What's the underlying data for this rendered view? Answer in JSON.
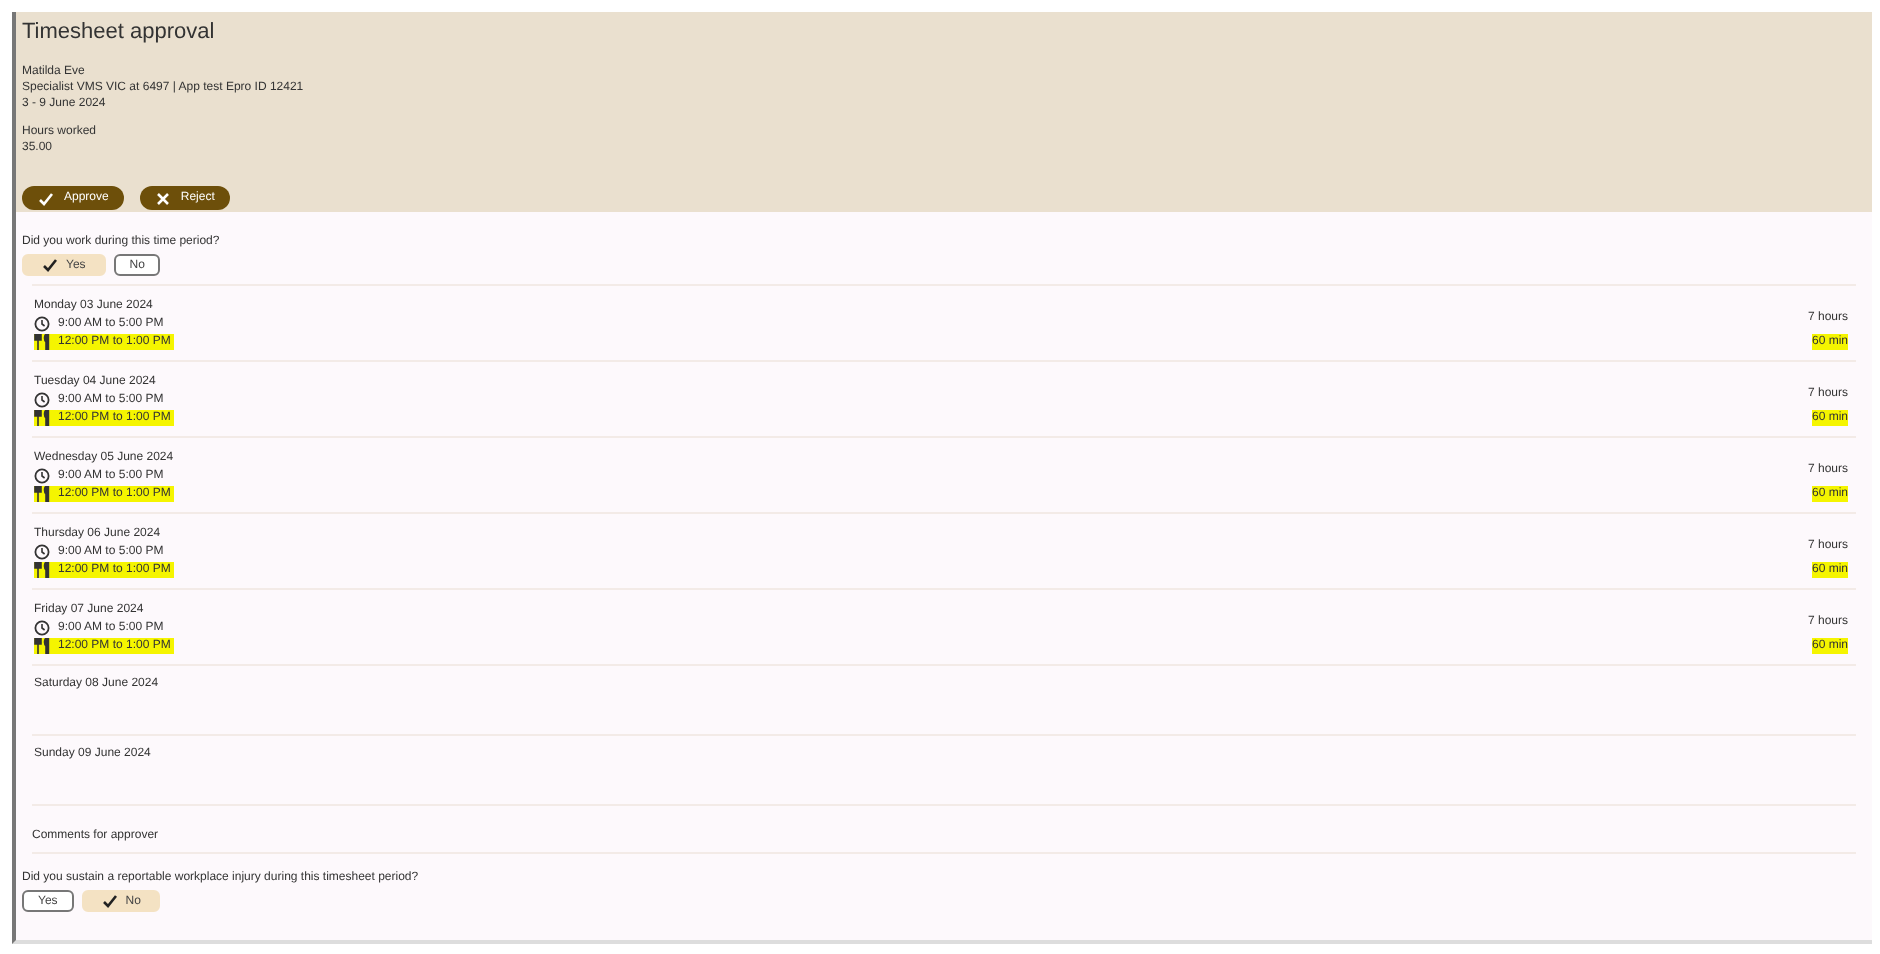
{
  "header": {
    "title": "Timesheet approval",
    "name": "Matilda Eve",
    "role": "Specialist VMS VIC at 6497 | App test Epro ID 12421",
    "period": "3 - 9 June 2024",
    "hours_label": "Hours worked",
    "hours_value": "35.00",
    "actions": [
      {
        "label": "Approve",
        "kind": "check"
      },
      {
        "label": "Reject",
        "kind": "cross"
      }
    ]
  },
  "work_question": {
    "text": "Did you work during this time period?",
    "options": [
      {
        "label": "Yes",
        "selected": true
      },
      {
        "label": "No",
        "selected": false
      }
    ]
  },
  "days": [
    {
      "date": "Monday 03 June 2024",
      "shift": "9:00 AM to 5:00 PM",
      "break": "12:00 PM to 1:00 PM",
      "hours": "7 hours",
      "break_length": "60 min",
      "highlighted": true
    },
    {
      "date": "Tuesday 04 June 2024",
      "shift": "9:00 AM to 5:00 PM",
      "break": "12:00 PM to 1:00 PM",
      "hours": "7 hours",
      "break_length": "60 min",
      "highlighted": true
    },
    {
      "date": "Wednesday 05 June 2024",
      "shift": "9:00 AM to 5:00 PM",
      "break": "12:00 PM to 1:00 PM",
      "hours": "7 hours",
      "break_length": "60 min",
      "highlighted": true
    },
    {
      "date": "Thursday 06 June 2024",
      "shift": "9:00 AM to 5:00 PM",
      "break": "12:00 PM to 1:00 PM",
      "hours": "7 hours",
      "break_length": "60 min",
      "highlighted": true
    },
    {
      "date": "Friday 07 June 2024",
      "shift": "9:00 AM to 5:00 PM",
      "break": "12:00 PM to 1:00 PM",
      "hours": "7 hours",
      "break_length": "60 min",
      "highlighted": true
    },
    {
      "date": "Saturday 08 June 2024"
    },
    {
      "date": "Sunday 09 June 2024"
    }
  ],
  "comments_label": "Comments for approver",
  "injury_question": {
    "text": "Did you sustain a reportable workplace injury during this timesheet period?",
    "options": [
      {
        "label": "Yes",
        "selected": false
      },
      {
        "label": "No",
        "selected": true
      }
    ]
  }
}
